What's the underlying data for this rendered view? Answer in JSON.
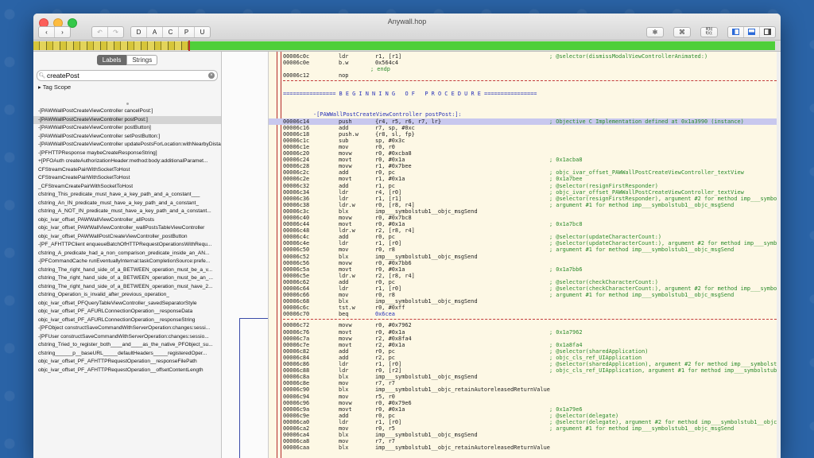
{
  "window": {
    "title": "Anywall.hop"
  },
  "toolbar": {
    "back": "‹",
    "forward": "›",
    "undo": "↶",
    "redo": "↷",
    "modes": [
      "D",
      "A",
      "C",
      "P",
      "U"
    ],
    "right_icons": [
      "gear-icon",
      "network-icon",
      "pseudocode-icon",
      "panel-left-icon",
      "panel-bottom-icon",
      "panel-right-icon"
    ],
    "pseudo_label": "if(b)\nf(x);"
  },
  "sidebar": {
    "tabs": [
      "Labels",
      "Strings"
    ],
    "search_value": "createPost",
    "tag_scope": "Tag Scope",
    "items": [
      "-[PAWWallPostCreateViewController cancelPost:]",
      "-[PAWWallPostCreateViewController postPost:]",
      "-[PAWWallPostCreateViewController postButton]",
      "-[PAWWallPostCreateViewController setPostButton:]",
      "-[PAWWallPostCreateViewController updatePostsForLocation:withNearbyDistance:]",
      "-[PFHTTPResponse maybeCreateResponseString]",
      "+[PFOAuth createAuthorizationHeader:method:body:additionalParamet...",
      "CFStreamCreatePairWithSocketToHost",
      "CFStreamCreatePairWithSocketToHost",
      "_CFStreamCreatePairWithSocketToHost",
      "cfstring_This_predicate_must_have_a_key_path_and_a_constant___",
      "cfstring_An_IN_predicate_must_have_a_key_path_and_a_constant_",
      "cfstring_A_NOT_IN_predicate_must_have_a_key_path_and_a_constant...",
      "objc_ivar_offset_PAWWallViewController_allPosts",
      "objc_ivar_offset_PAWWallViewController_wallPostsTableViewController",
      "objc_ivar_offset_PAWWallPostCreateViewController_postButton",
      "-[PF_AFHTTPClient enqueueBatchOfHTTPRequestOperationsWithRequ...",
      "cfstring_A_predicate_had_a_non_comparison_predicate_inside_an_AN...",
      "-[PFCommandCache runEventuallyInternal:taskCompletionSource:prefe...",
      "cfstring_The_right_hand_side_of_a_BETWEEN_operation_must_be_a_v...",
      "cfstring_The_right_hand_side_of_a_BETWEEN_operation_must_be_an_...",
      "cfstring_The_right_hand_side_of_a_BETWEEN_operation_must_have_2...",
      "cfstring_Operation_is_invalid_after_previous_operation_",
      "objc_ivar_offset_PFQueryTableViewController_savedSeparatorStyle",
      "objc_ivar_offset_PF_AFURLConnectionOperation__responseData",
      "objc_ivar_offset_PF_AFURLConnectionOperation__responseString",
      "-[PFObject constructSaveCommandWithServerOperation:changes:sessi...",
      "-[PFUser constructSaveCommandWithServerOperation:changes:sessio...",
      "cfstring_Tried_to_register_both____and____as_the_native_PFObject_su...",
      "cfstring______p__baseURL_____defaultHeaders_____registeredOper...",
      "objc_ivar_offset_PF_AFHTTPRequestOperation__responseFilePath",
      "objc_ivar_offset_PF_AFHTTPRequestOperation__offsetContentLength"
    ],
    "selected_index": 1
  },
  "code": {
    "top_lines": [
      {
        "addr": "00006c0c",
        "mn": "ldr",
        "op": "r1, [r1]",
        "cm": "; @selector(dismissModalViewControllerAnimated:)"
      },
      {
        "addr": "00006c0e",
        "mn": "b.w",
        "op": "0x564c4",
        "cm": ""
      },
      {
        "addr": "",
        "mn": "",
        "op": "",
        "cm": "",
        "endp": "; endp"
      },
      {
        "addr": "00006c12",
        "mn": "nop",
        "op": "",
        "cm": ""
      }
    ],
    "banner": "================ B E G I N N I N G   O F   P R O C E D U R E ================",
    "proc": "-[PAWWallPostCreateViewController postPost:]:",
    "lines": [
      {
        "addr": "00006c14",
        "mn": "push",
        "op": "{r4, r5, r6, r7, lr}",
        "cm": "; Objective C Implementation defined at 0x1a3990 (instance)",
        "hi": true
      },
      {
        "addr": "00006c16",
        "mn": "add",
        "op": "r7, sp, #0xc",
        "cm": ""
      },
      {
        "addr": "00006c18",
        "mn": "push.w",
        "op": "{r8, sl, fp}",
        "cm": ""
      },
      {
        "addr": "00006c1c",
        "mn": "sub",
        "op": "sp, #0x3c",
        "cm": ""
      },
      {
        "addr": "00006c1e",
        "mn": "mov",
        "op": "r0, r0",
        "cm": ""
      },
      {
        "addr": "00006c20",
        "mn": "movw",
        "op": "r0, #0xcba8",
        "cm": ""
      },
      {
        "addr": "00006c24",
        "mn": "movt",
        "op": "r0, #0x1a",
        "cm": "; 0x1acba8"
      },
      {
        "addr": "00006c28",
        "mn": "movw",
        "op": "r1, #0x7bee",
        "cm": ""
      },
      {
        "addr": "00006c2c",
        "mn": "add",
        "op": "r0, pc",
        "cm": "; objc_ivar_offset_PAWWallPostCreateViewController_textView"
      },
      {
        "addr": "00006c2e",
        "mn": "movt",
        "op": "r1, #0x1a",
        "cm": "; 0x1a7bee"
      },
      {
        "addr": "00006c32",
        "mn": "add",
        "op": "r1, pc",
        "cm": "; @selector(resignFirstResponder)"
      },
      {
        "addr": "00006c34",
        "mn": "ldr",
        "op": "r4, [r0]",
        "cm": "; objc_ivar_offset_PAWWallPostCreateViewController_textView"
      },
      {
        "addr": "00006c36",
        "mn": "ldr",
        "op": "r1, [r1]",
        "cm": "; @selector(resignFirstResponder), argument #2 for method imp___symbols"
      },
      {
        "addr": "00006c38",
        "mn": "ldr.w",
        "op": "r0, [r8, r4]",
        "cm": "; argument #1 for method imp___symbolstub1__objc_msgSend"
      },
      {
        "addr": "00006c3c",
        "mn": "blx",
        "op": "imp___symbolstub1__objc_msgSend",
        "cm": ""
      },
      {
        "addr": "00006c40",
        "mn": "movw",
        "op": "r0, #0x7bc8",
        "cm": ""
      },
      {
        "addr": "00006c44",
        "mn": "movt",
        "op": "r0, #0x1a",
        "cm": "; 0x1a7bc8"
      },
      {
        "addr": "00006c48",
        "mn": "ldr.w",
        "op": "r2, [r8, r4]",
        "cm": ""
      },
      {
        "addr": "00006c4c",
        "mn": "add",
        "op": "r0, pc",
        "cm": "; @selector(updateCharacterCount:)"
      },
      {
        "addr": "00006c4e",
        "mn": "ldr",
        "op": "r1, [r0]",
        "cm": "; @selector(updateCharacterCount:), argument #2 for method imp___symbol"
      },
      {
        "addr": "00006c50",
        "mn": "mov",
        "op": "r0, r8",
        "cm": "; argument #1 for method imp___symbolstub1__objc_msgSend"
      },
      {
        "addr": "00006c52",
        "mn": "blx",
        "op": "imp___symbolstub1__objc_msgSend",
        "cm": ""
      },
      {
        "addr": "00006c56",
        "mn": "movw",
        "op": "r0, #0x7bb6",
        "cm": ""
      },
      {
        "addr": "00006c5a",
        "mn": "movt",
        "op": "r0, #0x1a",
        "cm": "; 0x1a7bb6"
      },
      {
        "addr": "00006c5e",
        "mn": "ldr.w",
        "op": "r2, [r8, r4]",
        "cm": ""
      },
      {
        "addr": "00006c62",
        "mn": "add",
        "op": "r0, pc",
        "cm": "; @selector(checkCharacterCount:)"
      },
      {
        "addr": "00006c64",
        "mn": "ldr",
        "op": "r1, [r0]",
        "cm": "; @selector(checkCharacterCount:), argument #2 for method imp___symbols"
      },
      {
        "addr": "00006c66",
        "mn": "mov",
        "op": "r0, r8",
        "cm": "; argument #1 for method imp___symbolstub1__objc_msgSend"
      },
      {
        "addr": "00006c68",
        "mn": "blx",
        "op": "imp___symbolstub1__objc_msgSend",
        "cm": ""
      },
      {
        "addr": "00006c6c",
        "mn": "tst.w",
        "op": "r0, #0xff",
        "cm": ""
      },
      {
        "addr": "00006c70",
        "mn": "beq",
        "op": "0x6cea",
        "cm": "",
        "blue": true
      }
    ],
    "lines2": [
      {
        "addr": "00006c72",
        "mn": "movw",
        "op": "r0, #0x7962",
        "cm": ""
      },
      {
        "addr": "00006c76",
        "mn": "movt",
        "op": "r0, #0x1a",
        "cm": "; 0x1a7962"
      },
      {
        "addr": "00006c7a",
        "mn": "movw",
        "op": "r2, #0x8fa4",
        "cm": ""
      },
      {
        "addr": "00006c7e",
        "mn": "movt",
        "op": "r2, #0x1a",
        "cm": "; 0x1a8fa4"
      },
      {
        "addr": "00006c82",
        "mn": "add",
        "op": "r0, pc",
        "cm": "; @selector(sharedApplication)"
      },
      {
        "addr": "00006c84",
        "mn": "add",
        "op": "r2, pc",
        "cm": "; objc_cls_ref_UIApplication"
      },
      {
        "addr": "00006c86",
        "mn": "ldr",
        "op": "r1, [r0]",
        "cm": "; @selector(sharedApplication), argument #2 for method imp___symbolstub"
      },
      {
        "addr": "00006c88",
        "mn": "ldr",
        "op": "r0, [r2]",
        "cm": "; objc_cls_ref_UIApplication, argument #1 for method imp___symbolstub"
      },
      {
        "addr": "00006c8a",
        "mn": "blx",
        "op": "imp___symbolstub1__objc_msgSend",
        "cm": ""
      },
      {
        "addr": "00006c8e",
        "mn": "mov",
        "op": "r7, r7",
        "cm": ""
      },
      {
        "addr": "00006c90",
        "mn": "blx",
        "op": "imp___symbolstub1__objc_retainAutoreleasedReturnValue",
        "cm": ""
      },
      {
        "addr": "00006c94",
        "mn": "mov",
        "op": "r5, r0",
        "cm": ""
      },
      {
        "addr": "00006c96",
        "mn": "movw",
        "op": "r0, #0x79e6",
        "cm": ""
      },
      {
        "addr": "00006c9a",
        "mn": "movt",
        "op": "r0, #0x1a",
        "cm": "; 0x1a79e6"
      },
      {
        "addr": "00006c9e",
        "mn": "add",
        "op": "r0, pc",
        "cm": "; @selector(delegate)"
      },
      {
        "addr": "00006ca0",
        "mn": "ldr",
        "op": "r1, [r0]",
        "cm": "; @selector(delegate), argument #2 for method imp___symbolstub1__objc_m"
      },
      {
        "addr": "00006ca2",
        "mn": "mov",
        "op": "r0, r5",
        "cm": "; argument #1 for method imp___symbolstub1__objc_msgSend"
      },
      {
        "addr": "00006ca4",
        "mn": "blx",
        "op": "imp___symbolstub1__objc_msgSend",
        "cm": ""
      },
      {
        "addr": "00006ca8",
        "mn": "mov",
        "op": "r7, r7",
        "cm": ""
      },
      {
        "addr": "00006caa",
        "mn": "blx",
        "op": "imp___symbolstub1__objc_retainAutoreleasedReturnValue",
        "cm": ""
      }
    ]
  }
}
